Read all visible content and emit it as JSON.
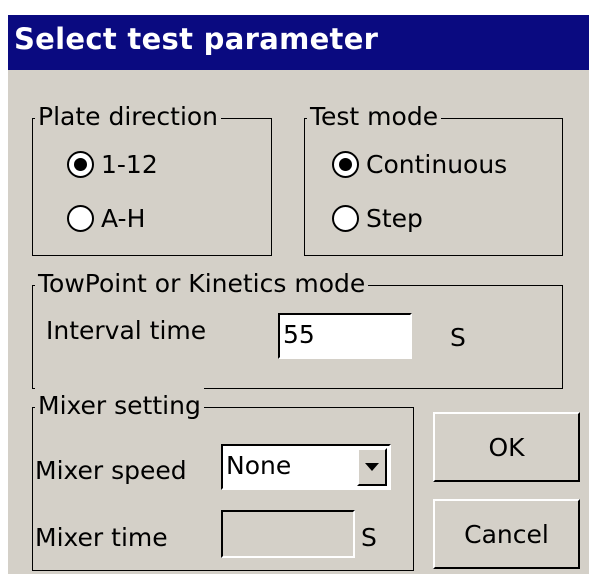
{
  "window": {
    "title": "Select test parameter"
  },
  "plate_direction": {
    "legend": "Plate direction",
    "options": [
      {
        "label": "1-12",
        "selected": true
      },
      {
        "label": "A-H",
        "selected": false
      }
    ]
  },
  "test_mode": {
    "legend": "Test mode",
    "options": [
      {
        "label": "Continuous",
        "selected": true
      },
      {
        "label": "Step",
        "selected": false
      }
    ]
  },
  "kinetics": {
    "legend": "TowPoint or Kinetics mode",
    "interval_label": "Interval time",
    "interval_value": "55",
    "interval_unit": "S"
  },
  "mixer": {
    "legend": "Mixer setting",
    "speed_label": "Mixer speed",
    "speed_value": "None",
    "time_label": "Mixer time",
    "time_value": "",
    "time_unit": "S"
  },
  "buttons": {
    "ok": "OK",
    "cancel": "Cancel"
  }
}
